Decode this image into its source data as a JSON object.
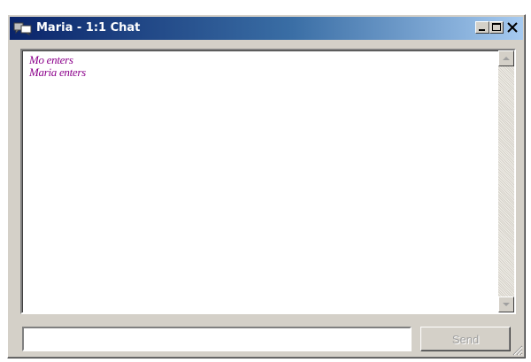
{
  "window": {
    "title": "Maria - 1:1 Chat"
  },
  "titlebar_buttons": {
    "minimize_icon": "minimize-icon",
    "maximize_icon": "maximize-icon",
    "close_icon": "close-icon"
  },
  "chat": {
    "messages": [
      "Mo enters",
      "Maria enters"
    ]
  },
  "composer": {
    "input_value": "",
    "send_label": "Send"
  },
  "colors": {
    "title_gradient_start": "#0a246a",
    "title_gradient_end": "#a6caf0",
    "system_message": "#8b008b",
    "window_face": "#d4d0c8"
  }
}
